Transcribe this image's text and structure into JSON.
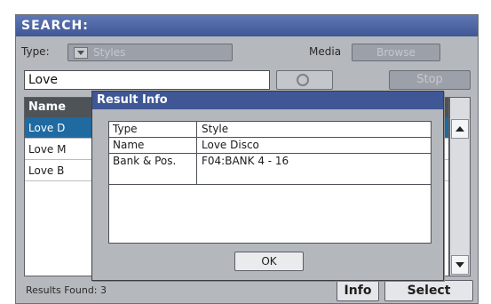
{
  "header": {
    "title": "SEARCH:"
  },
  "filters": {
    "type_label": "Type:",
    "type_value": "Styles",
    "media_label": "Media",
    "browse_label": "Browse"
  },
  "search": {
    "value": "Love",
    "stop_label": "Stop"
  },
  "results": {
    "column_header": "Name",
    "rows": [
      "Love D",
      "Love M",
      "Love B"
    ],
    "selected_index": 0,
    "found_text": "Results Found: 3"
  },
  "footer": {
    "info_label": "Info",
    "select_label": "Select"
  },
  "dialog": {
    "title": "Result Info",
    "rows": [
      {
        "key": "Type",
        "value": "Style"
      },
      {
        "key": "Name",
        "value": "Love Disco"
      },
      {
        "key": "Bank & Pos.",
        "value": "F04:BANK 4 - 16"
      }
    ],
    "ok_label": "OK"
  },
  "colors": {
    "title_bar": "#3f5795",
    "selection": "#1f6aa0",
    "panel": "#b5b8bd"
  },
  "icons": [
    "dropdown-arrow-icon",
    "search-icon",
    "scroll-up-icon",
    "scroll-down-icon"
  ]
}
